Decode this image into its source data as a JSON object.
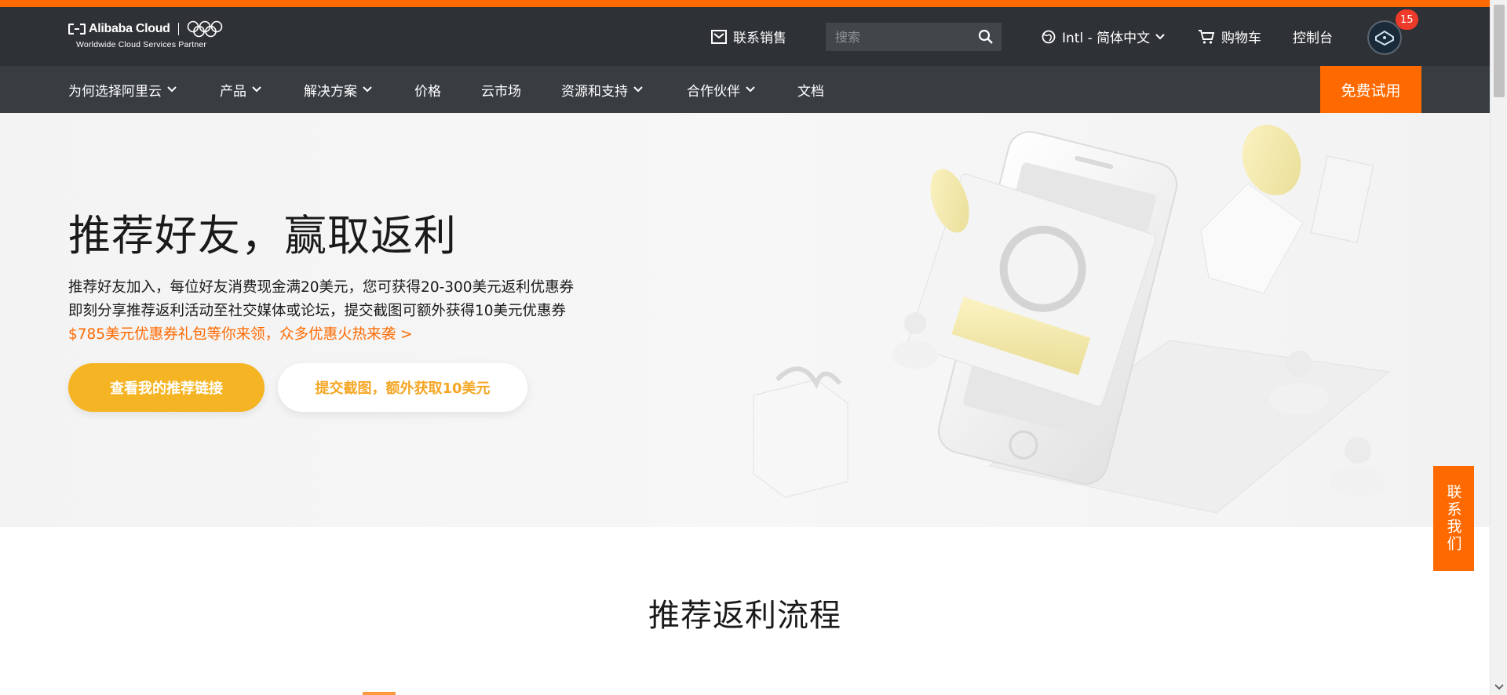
{
  "header": {
    "logo": {
      "brand": "Alibaba Cloud",
      "tagline": "Worldwide Cloud Services Partner"
    },
    "contact_sales": "联系销售",
    "search": {
      "placeholder": "搜索"
    },
    "language": "Intl - 简体中文",
    "cart": "购物车",
    "console": "控制台",
    "notifications": "15"
  },
  "nav": {
    "items": [
      {
        "label": "为何选择阿里云"
      },
      {
        "label": "产品"
      },
      {
        "label": "解决方案"
      },
      {
        "label": "价格"
      },
      {
        "label": "云市场"
      },
      {
        "label": "资源和支持"
      },
      {
        "label": "合作伙伴"
      },
      {
        "label": "文档"
      }
    ],
    "trial": "免费试用"
  },
  "hero": {
    "title": "推荐好友，赢取返利",
    "line1": "推荐好友加入，每位好友消费现金满20美元，您可获得20-300美元返利优惠券",
    "line2": "即刻分享推荐返利活动至社交媒体或论坛，提交截图可额外获得10美元优惠券",
    "promo": "$785美元优惠券礼包等你来领，众多优惠火热来袭 >",
    "btn_primary": "查看我的推荐链接",
    "btn_secondary": "提交截图，额外获取10美元"
  },
  "section": {
    "title": "推荐返利流程"
  },
  "contact_float": "联系我们",
  "colors": {
    "accent": "#ff6a00",
    "topbar": "#2e3236",
    "navbar": "#383d42",
    "button_yellow": "#f5b423",
    "badge": "#ee3a2a"
  },
  "icons": [
    "mail-icon",
    "search-icon",
    "globe-icon",
    "chevron-down-icon",
    "cart-icon",
    "avatar",
    "olympic-rings-icon"
  ]
}
